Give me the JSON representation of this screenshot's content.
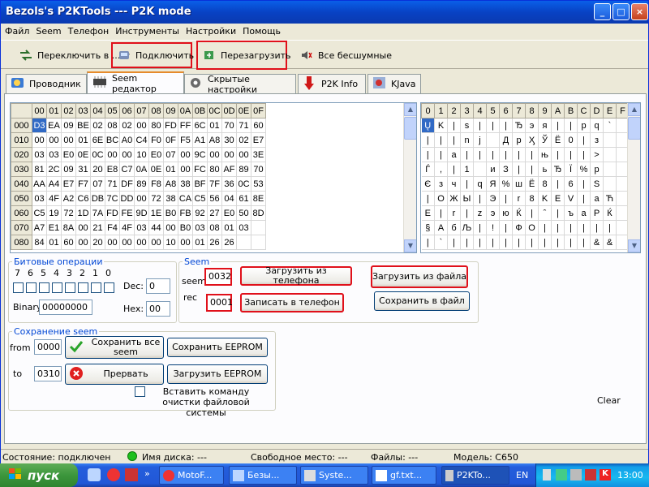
{
  "window": {
    "title": "Bezols's P2KTools --- P2K mode"
  },
  "menu": [
    "Файл",
    "Seem",
    "Телефон",
    "Инструменты",
    "Настройки",
    "Помощь"
  ],
  "toolbar": {
    "switch": "Переключить в ...",
    "connect": "Подключить",
    "reboot": "Перезагрузить",
    "silent": "Все бесшумные"
  },
  "tabs": [
    "Проводник",
    "Seem редактор",
    "Скрытые настройки",
    "P2K Info",
    "KJava"
  ],
  "hex": {
    "headers": [
      "00",
      "01",
      "02",
      "03",
      "04",
      "05",
      "06",
      "07",
      "08",
      "09",
      "0A",
      "0B",
      "0C",
      "0D",
      "0E",
      "0F"
    ],
    "rows": [
      {
        "addr": "000",
        "cells": [
          "D3",
          "EA",
          "09",
          "BE",
          "02",
          "08",
          "02",
          "00",
          "80",
          "FD",
          "FF",
          "6C",
          "01",
          "70",
          "71",
          "60"
        ]
      },
      {
        "addr": "010",
        "cells": [
          "00",
          "00",
          "00",
          "01",
          "6E",
          "BC",
          "A0",
          "C4",
          "F0",
          "0F",
          "F5",
          "A1",
          "A8",
          "30",
          "02",
          "E7"
        ]
      },
      {
        "addr": "020",
        "cells": [
          "03",
          "03",
          "E0",
          "0E",
          "0C",
          "00",
          "00",
          "10",
          "E0",
          "07",
          "00",
          "9C",
          "00",
          "00",
          "00",
          "3E"
        ]
      },
      {
        "addr": "030",
        "cells": [
          "81",
          "2C",
          "09",
          "31",
          "20",
          "E8",
          "C7",
          "0A",
          "0E",
          "01",
          "00",
          "FC",
          "80",
          "AF",
          "89",
          "70"
        ]
      },
      {
        "addr": "040",
        "cells": [
          "AA",
          "A4",
          "E7",
          "F7",
          "07",
          "71",
          "DF",
          "89",
          "F8",
          "A8",
          "38",
          "BF",
          "7F",
          "36",
          "0C",
          "53"
        ]
      },
      {
        "addr": "050",
        "cells": [
          "03",
          "4F",
          "A2",
          "C6",
          "DB",
          "7C",
          "DD",
          "00",
          "72",
          "38",
          "CA",
          "C5",
          "56",
          "04",
          "61",
          "8E"
        ]
      },
      {
        "addr": "060",
        "cells": [
          "C5",
          "19",
          "72",
          "1D",
          "7A",
          "FD",
          "FE",
          "9D",
          "1E",
          "B0",
          "FB",
          "92",
          "27",
          "E0",
          "50",
          "8D"
        ]
      },
      {
        "addr": "070",
        "cells": [
          "A7",
          "E1",
          "8A",
          "00",
          "21",
          "F4",
          "4F",
          "03",
          "44",
          "00",
          "B0",
          "03",
          "08",
          "01",
          "03"
        ]
      },
      {
        "addr": "080",
        "cells": [
          "84",
          "01",
          "60",
          "00",
          "20",
          "00",
          "00",
          "00",
          "00",
          "10",
          "00",
          "01",
          "26",
          "26"
        ]
      }
    ]
  },
  "chars": {
    "headers": [
      "0",
      "1",
      "2",
      "3",
      "4",
      "5",
      "6",
      "7",
      "8",
      "9",
      "A",
      "B",
      "C",
      "D",
      "E",
      "F"
    ],
    "rows": [
      [
        "Ų",
        "K",
        "|",
        "s",
        "|",
        "|",
        "|",
        "Ђ",
        "э",
        "я",
        "|",
        "|",
        "p",
        "q",
        "`",
        ""
      ],
      [
        "|",
        "|",
        "|",
        "n",
        "j",
        "",
        "Д",
        "р",
        "Ӽ",
        "Ў",
        "Ё",
        "0",
        "|",
        "з",
        "",
        ""
      ],
      [
        "|",
        "|",
        "a",
        "|",
        "|",
        "|",
        "|",
        "|",
        "|",
        "њ",
        "|",
        "|",
        "|",
        ">",
        "",
        ""
      ],
      [
        "Ѓ",
        ",",
        "|",
        "1",
        "",
        "и",
        "З",
        "|",
        "|",
        "ь",
        "Ђ",
        "Ї",
        "%",
        "р",
        "",
        ""
      ],
      [
        "Є",
        "з",
        "ч",
        "|",
        "q",
        "Я",
        "%",
        "ш",
        "Ё",
        "8",
        "|",
        "6",
        "|",
        "S",
        "",
        ""
      ],
      [
        "|",
        "О",
        "Ж",
        "Ы",
        "|",
        "Э",
        "|",
        "r",
        "8",
        "K",
        "E",
        "V",
        "|",
        "a",
        "Ћ",
        ""
      ],
      [
        "Е",
        "|",
        "r",
        "|",
        "z",
        "э",
        "ю",
        "Ќ",
        "|",
        "ˆ",
        "|",
        "ъ",
        "a",
        "P",
        "Ќ",
        ""
      ],
      [
        "§",
        "А",
        "б",
        "Љ",
        "|",
        "!",
        "|",
        "Ф",
        "О",
        "|",
        "|",
        "|",
        "|",
        "|",
        "|",
        ""
      ],
      [
        "|",
        "`",
        "|",
        "|",
        "|",
        "|",
        "|",
        "|",
        "|",
        "|",
        "|",
        "|",
        "|",
        "&",
        "&",
        ""
      ]
    ]
  },
  "bitops": {
    "legend": "Битовые операции",
    "bits": [
      "7",
      "6",
      "5",
      "4",
      "3",
      "2",
      "1",
      "0"
    ],
    "dec_label": "Dec:",
    "dec_value": "0",
    "binary_label": "Binary:",
    "binary_value": "00000000",
    "hex_label": "Hex:",
    "hex_value": "00"
  },
  "seem": {
    "legend": "Seem",
    "seem_label": "seem",
    "seem_value": "0032",
    "rec_label": "rec",
    "rec_value": "0001",
    "load_phone": "Загрузить из телефона",
    "load_file": "Загрузить из файла",
    "write_phone": "Записать в телефон",
    "save_file": "Сохранить в файл"
  },
  "save": {
    "legend": "Сохранение seem",
    "from_label": "from",
    "from_value": "0000",
    "to_label": "to",
    "to_value": "0310",
    "save_all": "Сохранить все seem",
    "abort": "Прервать",
    "save_eeprom": "Сохранить EEPROM",
    "load_eeprom": "Загрузить EEPROM",
    "checkbox": "Вставить команду очистки файловой системы"
  },
  "clear": "Clear",
  "status": {
    "state": "Состояние: подключен",
    "disk": "Имя диска: ---",
    "free": "Свободное место: ---",
    "files": "Файлы: ---",
    "model": "Модель: C650"
  },
  "taskbar": {
    "start": "пуск",
    "tasks": [
      "MotoF...",
      "Безы...",
      "Syste...",
      "gf.txt...",
      "P2KTo..."
    ],
    "lang": "EN",
    "time": "13:00"
  }
}
